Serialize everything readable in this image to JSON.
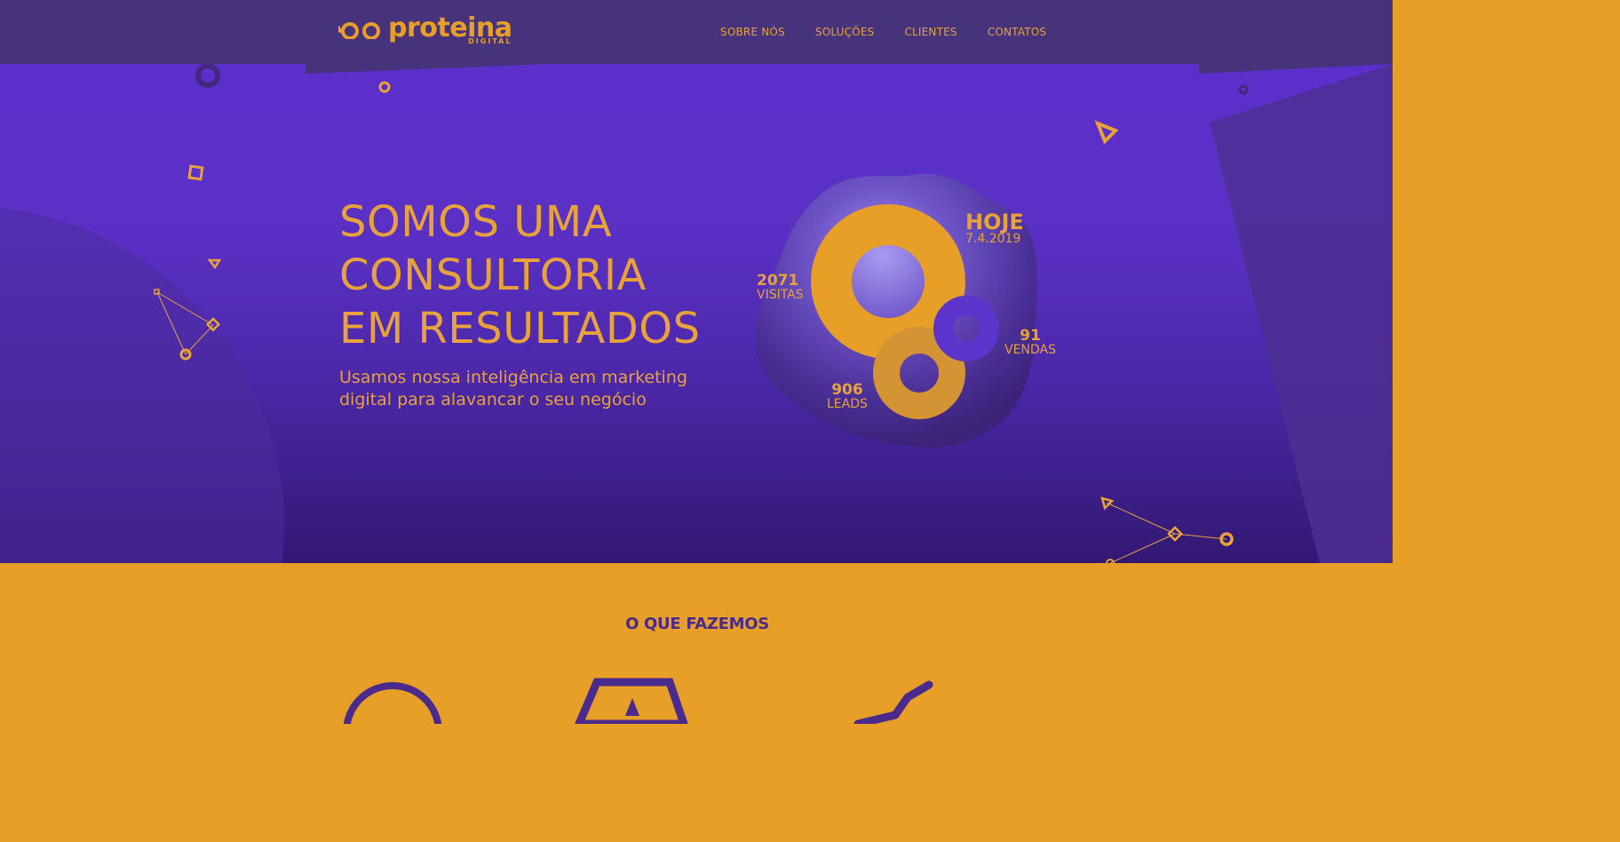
{
  "header": {
    "logo_name": "proteina",
    "logo_sub": "DIGITAL",
    "nav": [
      "SOBRE NÓS",
      "SOLUÇÕES",
      "CLIENTES",
      "CONTATOS"
    ]
  },
  "hero": {
    "title_lines": [
      "SOMOS UMA",
      "CONSULTORIA",
      "EM RESULTADOS"
    ],
    "subtitle_lines": [
      "Usamos nossa inteligência em marketing",
      "digital para alavancar o seu negócio"
    ],
    "stats": {
      "today": {
        "label": "HOJE",
        "date": "7.4.2019"
      },
      "visits": {
        "value": "2071",
        "label": "VISITAS"
      },
      "sales": {
        "value": "91",
        "label": "VENDAS"
      },
      "leads": {
        "value": "906",
        "label": "LEADS"
      }
    }
  },
  "section": {
    "title": "O QUE FAZEMOS"
  },
  "colors": {
    "header_bg": "#46337c",
    "hero_top": "#5d2fcb",
    "hero_bottom": "#321872",
    "accent": "#e89f28",
    "dark_purple": "#4a2a8c"
  }
}
